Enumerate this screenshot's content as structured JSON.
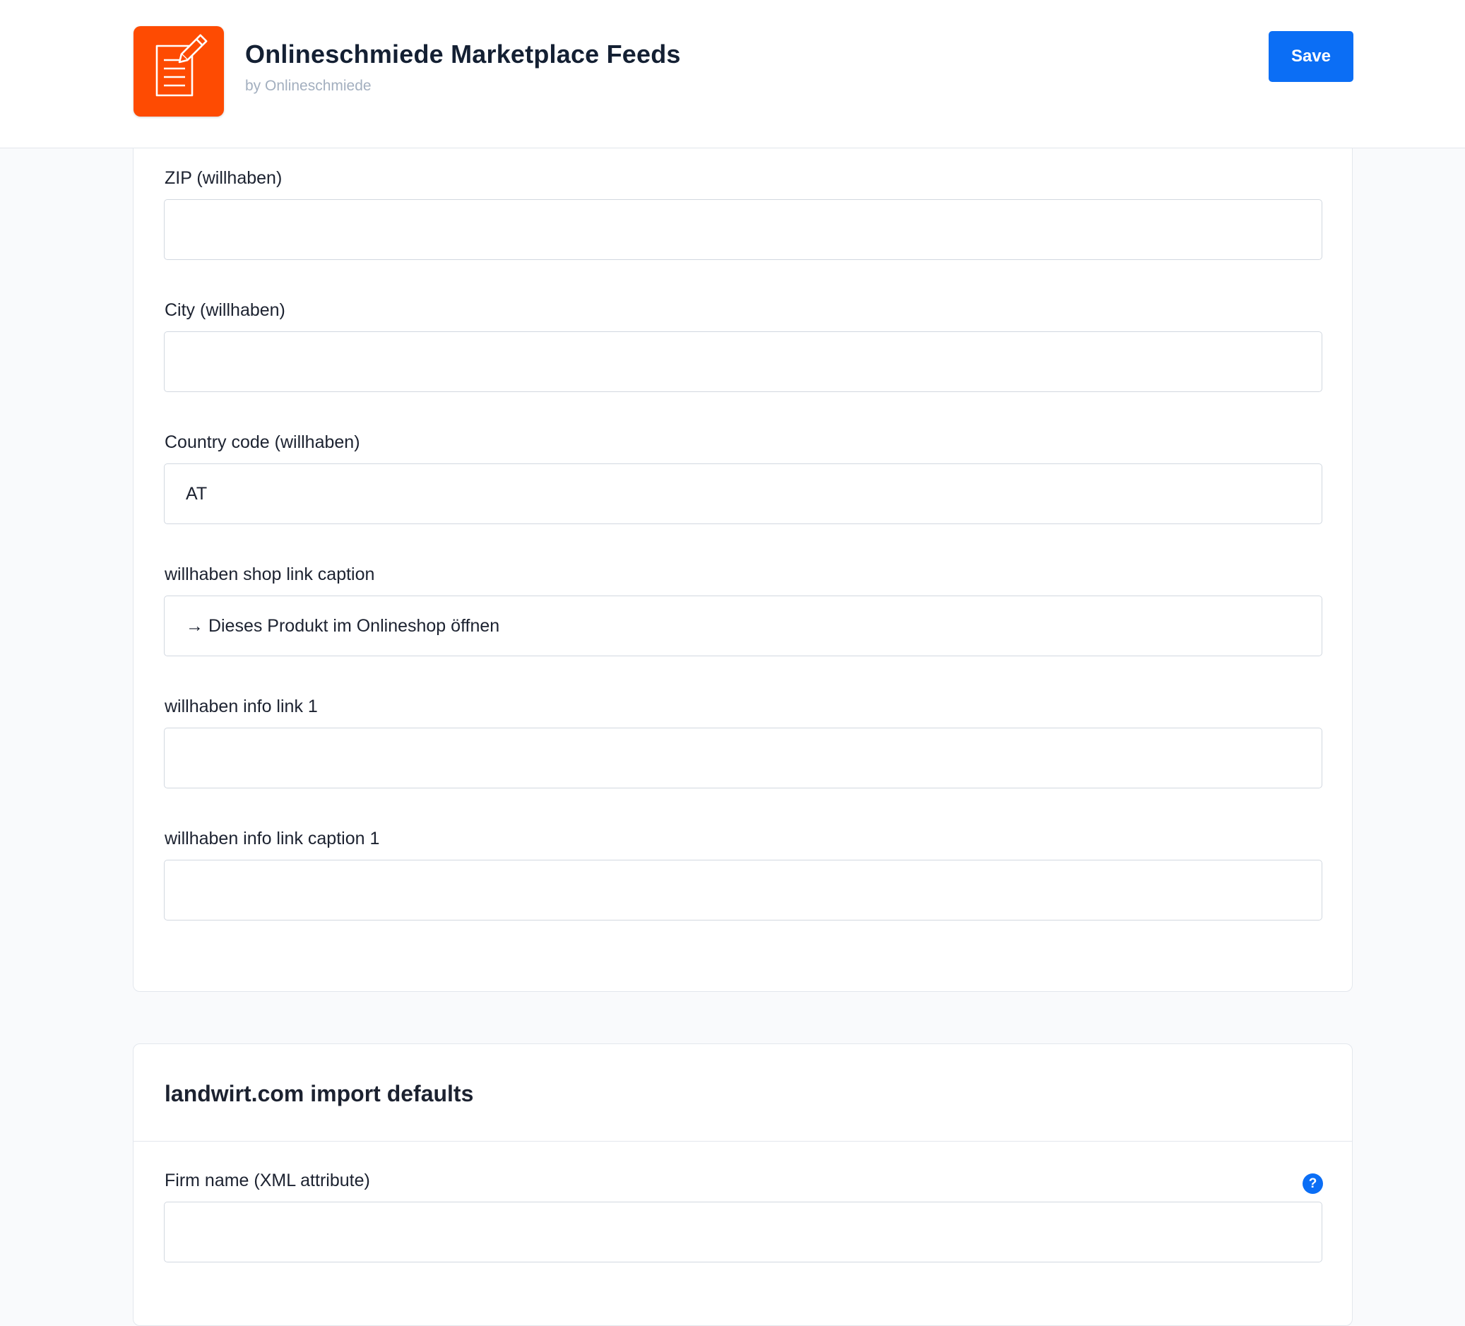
{
  "header": {
    "app_name": "Onlineschmiede Marketplace Feeds",
    "vendor": "by Onlineschmiede",
    "save_label": "Save",
    "icon": "notepad-edit-icon",
    "brand_color": "#fe4b02",
    "accent_color": "#0b6ef5"
  },
  "willhaben_section": {
    "fields": [
      {
        "label": "ZIP (willhaben)",
        "value": ""
      },
      {
        "label": "City (willhaben)",
        "value": ""
      },
      {
        "label": "Country code (willhaben)",
        "value": "AT"
      },
      {
        "label": "willhaben shop link caption",
        "value": "→ Dieses Produkt im Onlineshop öffnen"
      },
      {
        "label": "willhaben info link 1",
        "value": ""
      },
      {
        "label": "willhaben info link caption 1",
        "value": ""
      }
    ]
  },
  "landwirt_section": {
    "title": "landwirt.com import defaults",
    "fields": [
      {
        "label": "Firm name (XML attribute)",
        "value": "",
        "help": "?"
      }
    ]
  }
}
